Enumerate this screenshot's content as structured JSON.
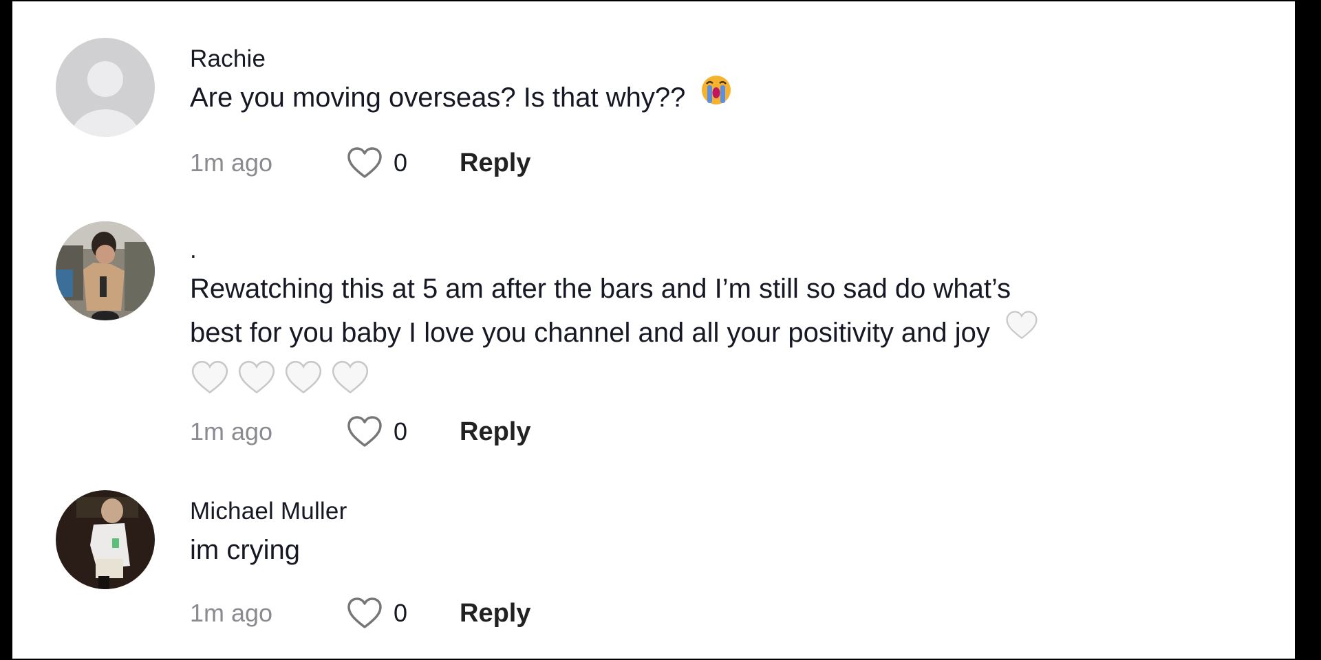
{
  "comments": [
    {
      "username": "Rachie",
      "avatar": "default-avatar",
      "text": "Are you moving overseas? Is that why??",
      "trailing_emoji": "loudly-crying-face-emoji",
      "time": "1m ago",
      "likes": "0",
      "reply_label": "Reply"
    },
    {
      "username": ".",
      "avatar": "photo-avatar",
      "text_lines": [
        "Rewatching this at 5 am after the bars and I’m still so sad do what’s",
        "best for you baby I love you channel and all your positivity and joy"
      ],
      "trailing_emoji": "white-heart-emoji",
      "extra_emojis": [
        "white-heart-emoji",
        "white-heart-emoji",
        "white-heart-emoji",
        "white-heart-emoji"
      ],
      "time": "1m ago",
      "likes": "0",
      "reply_label": "Reply"
    },
    {
      "username": "Michael Muller",
      "avatar": "photo-avatar",
      "text": "im crying",
      "time": "1m ago",
      "likes": "0",
      "reply_label": "Reply"
    }
  ],
  "colors": {
    "text_primary": "#161823",
    "text_secondary": "#8a8b91",
    "heart_outline": "#777777",
    "avatar_default_bg": "#d0d0d2",
    "frame": "#000000"
  }
}
